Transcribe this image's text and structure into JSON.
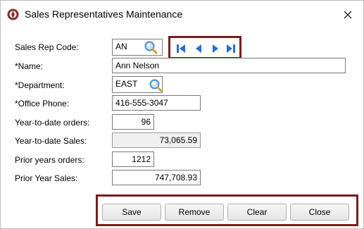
{
  "window": {
    "title": "Sales Representatives Maintenance"
  },
  "form": {
    "sales_rep_code": {
      "label": "Sales Rep Code:",
      "value": "AN"
    },
    "name": {
      "label": "*Name:",
      "value": "Ann Nelson"
    },
    "department": {
      "label": "*Department:",
      "value": "EAST"
    },
    "office_phone": {
      "label": "*Office Phone:",
      "value": "416-555-3047"
    },
    "ytd_orders": {
      "label": "Year-to-date orders:",
      "value": "96"
    },
    "ytd_sales": {
      "label": "Year-to-date Sales:",
      "value": "73,065.59"
    },
    "prior_orders": {
      "label": "Prior years orders:",
      "value": "1212"
    },
    "prior_sales": {
      "label": "Prior Year Sales:",
      "value": "747,708.93"
    }
  },
  "buttons": {
    "save": "Save",
    "remove": "Remove",
    "clear": "Clear",
    "close": "Close"
  },
  "colors": {
    "nav_accent": "#2b6cd4",
    "highlight_border": "#7b1c1c",
    "lookup_icon": "#4a90d9"
  },
  "icons": {
    "app": "app-logo-icon",
    "close": "close-icon",
    "lookup": "magnifier-icon",
    "nav": [
      "first-record-icon",
      "previous-record-icon",
      "next-record-icon",
      "last-record-icon"
    ]
  }
}
